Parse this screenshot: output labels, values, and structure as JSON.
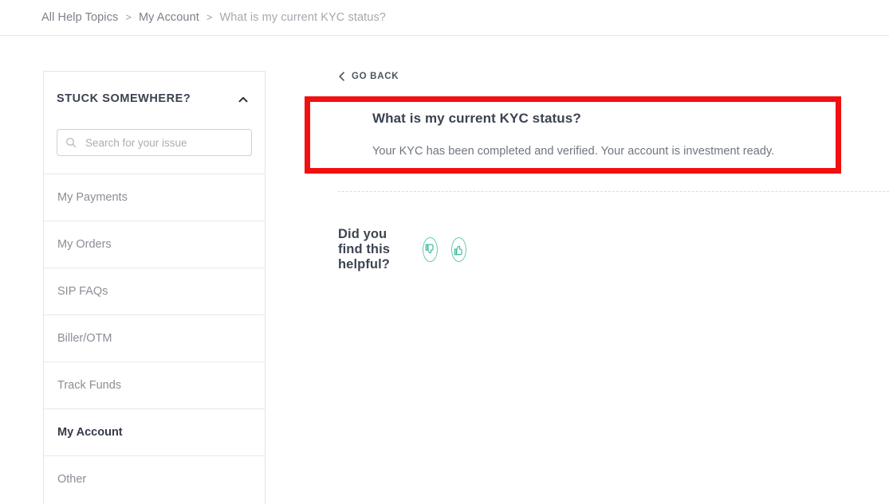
{
  "breadcrumb": {
    "items": [
      {
        "label": "All Help Topics",
        "current": false
      },
      {
        "label": "My Account",
        "current": false
      },
      {
        "label": "What is my current KYC status?",
        "current": true
      }
    ],
    "separator": ">"
  },
  "sidebar": {
    "title": "STUCK SOMEWHERE?",
    "collapse_icon": "chevron-up-icon",
    "search": {
      "icon": "search-icon",
      "placeholder": "Search for your issue",
      "value": ""
    },
    "items": [
      {
        "label": "My Payments",
        "active": false
      },
      {
        "label": "My Orders",
        "active": false
      },
      {
        "label": "SIP FAQs",
        "active": false
      },
      {
        "label": "Biller/OTM",
        "active": false
      },
      {
        "label": "Track Funds",
        "active": false
      },
      {
        "label": "My Account",
        "active": true
      },
      {
        "label": "Other",
        "active": false
      }
    ]
  },
  "main": {
    "go_back": {
      "label": "GO BACK",
      "icon": "chevron-left-icon"
    },
    "answer": {
      "title": "What is my current KYC status?",
      "body": "Your KYC has been completed and verified. Your account is investment ready."
    },
    "feedback": {
      "label": "Did you find this helpful?",
      "thumbs_down_icon": "thumbs-down-icon",
      "thumbs_up_icon": "thumbs-up-icon"
    }
  },
  "colors": {
    "highlight_border": "#f20f0f",
    "accent_teal": "#63cbb0",
    "text_dark": "#3b4350",
    "text_muted": "#8a8e95"
  }
}
